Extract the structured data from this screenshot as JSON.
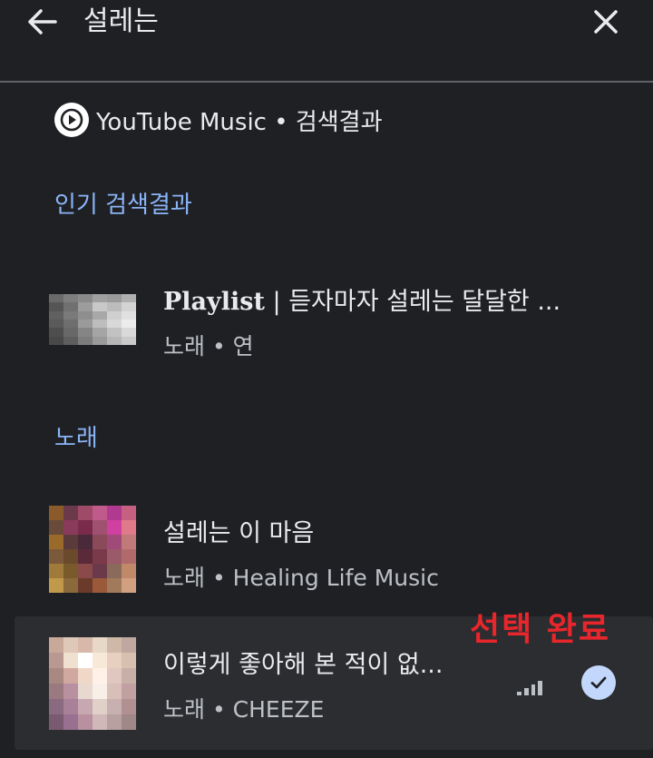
{
  "header": {
    "search_query": "설레는",
    "back_icon": "arrow-left-icon",
    "close_icon": "close-icon"
  },
  "source": {
    "label": "YouTube Music • 검색결과",
    "icon": "youtube-music-logo"
  },
  "sections": {
    "top_results_title": "인기 검색결과",
    "songs_title": "노래"
  },
  "top_result": {
    "title_bold": "Playlist",
    "title_rest": " | 듣자마자 설레는 달달한 ...",
    "subtitle": "노래 • 연"
  },
  "songs": [
    {
      "title": "설레는 이 마음",
      "subtitle": "노래 • Healing Life Music"
    },
    {
      "title": "이렇게 좋아해 본 적이 없...",
      "subtitle": "노래 • CHEEZE",
      "selected": true
    }
  ],
  "annotation": "선택 완료",
  "colors": {
    "background": "#1f2023",
    "accent": "#8ab4f8",
    "annotation": "#e8262b",
    "check": "#c2d7fb"
  }
}
